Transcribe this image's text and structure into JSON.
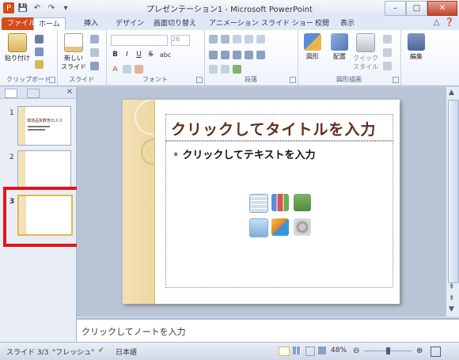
{
  "window": {
    "title": "プレゼンテーション1 - Microsoft PowerPoint"
  },
  "tabs": [
    "ファイル",
    "ホーム",
    "挿入",
    "デザイン",
    "画面切り替え",
    "アニメーション",
    "スライド ショー",
    "校閲",
    "表示"
  ],
  "ribbon": {
    "groups": {
      "clipboard": "クリップボード",
      "slides": "スライド",
      "font": "フォント",
      "paragraph": "段落",
      "drawing": "図形描画",
      "edit": "編集"
    },
    "buttons": {
      "paste": "貼り付け",
      "new_slide": "新しい スライド",
      "shapes": "図形",
      "arrange": "配置",
      "quick_style": "クイック スタイル",
      "edit": "編集"
    },
    "font_size": "26",
    "format": [
      "B",
      "I",
      "U",
      "S",
      "abc",
      "A"
    ]
  },
  "slides_pane": {
    "thumbnails": [
      {
        "num": "1",
        "text": "環境品質教育のスス"
      },
      {
        "num": "2",
        "text": ""
      },
      {
        "num": "3",
        "text": ""
      }
    ]
  },
  "slide": {
    "title_placeholder": "クリックしてタイトルを入力",
    "body_placeholder": "クリックしてテキストを入力"
  },
  "notes": {
    "placeholder": "クリックしてノートを入力"
  },
  "status": {
    "slide_count": "スライド 3/3",
    "theme": "\"フレッシュ\"",
    "language": "日本語",
    "zoom": "48%"
  }
}
